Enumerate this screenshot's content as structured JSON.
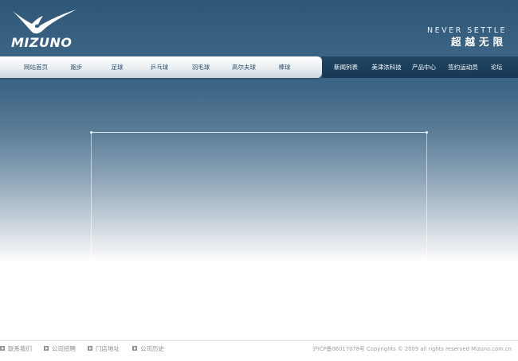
{
  "header": {
    "logo_text": "MIZUNO",
    "slogan_en": "NEVER SETTLE",
    "slogan_cn": "超越无限"
  },
  "nav": {
    "left_items": [
      {
        "label": "网站首页"
      },
      {
        "label": "跑步"
      },
      {
        "label": "足球"
      },
      {
        "label": "乒乓球"
      },
      {
        "label": "羽毛球"
      },
      {
        "label": "高尔夫球"
      },
      {
        "label": "棒球"
      }
    ],
    "right_items": [
      {
        "label": "新闻列表"
      },
      {
        "label": "美津浓科技"
      },
      {
        "label": "产品中心"
      },
      {
        "label": "签约运动员"
      },
      {
        "label": "论坛"
      }
    ]
  },
  "footer": {
    "links": [
      {
        "label": "联系我们"
      },
      {
        "label": "公司招聘"
      },
      {
        "label": "门店地址"
      },
      {
        "label": "公司历史"
      }
    ],
    "copyright": "沪ICP备06017078号  Copyrights © 2009 all rights reserved Mizuno.com.cn"
  },
  "colors": {
    "header_blue": "#2e5677",
    "nav_dark": "#1f4664",
    "nav_text": "#2c4f6b"
  }
}
